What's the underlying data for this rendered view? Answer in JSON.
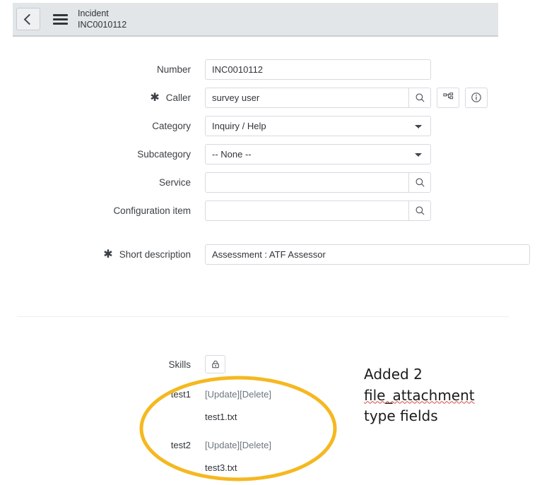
{
  "header": {
    "back_icon": "chevron-left-icon",
    "menu_icon": "hamburger-icon",
    "record_type": "Incident",
    "record_number": "INC0010112"
  },
  "form": {
    "fields": [
      {
        "label": "Number",
        "value": "INC0010112",
        "type": "text",
        "required": false
      },
      {
        "label": "Caller",
        "value": "survey user",
        "type": "reference",
        "required": true,
        "search_icon": "search-icon",
        "extra_buttons": [
          "hierarchy-icon",
          "info-icon"
        ]
      },
      {
        "label": "Category",
        "value": "Inquiry / Help",
        "type": "select",
        "required": false,
        "chevron_icon": "chevron-down-icon"
      },
      {
        "label": "Subcategory",
        "value": "-- None --",
        "type": "select",
        "required": false,
        "chevron_icon": "chevron-down-icon"
      },
      {
        "label": "Service",
        "value": "",
        "type": "reference",
        "required": false,
        "search_icon": "search-icon"
      },
      {
        "label": "Configuration item",
        "value": "",
        "type": "reference",
        "required": false,
        "search_icon": "search-icon"
      }
    ],
    "short_description": {
      "label": "Short description",
      "value": "Assessment : ATF Assessor",
      "required": true
    }
  },
  "skills": {
    "label": "Skills",
    "lock_icon": "lock-icon"
  },
  "attachments": [
    {
      "field_name": "test1",
      "actions": "[Update][Delete]",
      "file_name": "test1.txt"
    },
    {
      "field_name": "test2",
      "actions": "[Update][Delete]",
      "file_name": "test3.txt"
    }
  ],
  "annotation": {
    "line1": "Added 2",
    "line2": "file_attachment",
    "line3": "type fields",
    "highlight_color": "#f5b820"
  }
}
